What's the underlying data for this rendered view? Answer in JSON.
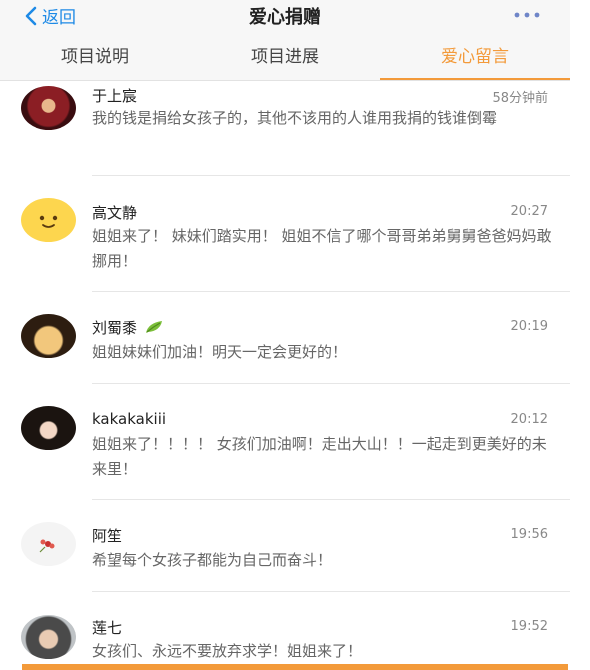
{
  "nav": {
    "back_label": "返回",
    "title": "爱心捐赠"
  },
  "tabs": [
    {
      "label": "项目说明",
      "active": false
    },
    {
      "label": "项目进展",
      "active": false
    },
    {
      "label": "爱心留言",
      "active": true
    }
  ],
  "colors": {
    "accent": "#f39a3a",
    "link": "#1e8ae6"
  },
  "comments": [
    {
      "name": "于上宸",
      "time": "58分钟前",
      "text": "我的钱是捐给女孩子的，其他不该用的人谁用我捐的钱谁倒霉",
      "avatar": "photo-red"
    },
    {
      "name": "高文静",
      "time": "20:27",
      "text": "姐姐来了！ 妹妹们踏实用！ 姐姐不信了哪个哥哥弟弟舅舅爸爸妈妈敢挪用！",
      "avatar": "emoji-smile"
    },
    {
      "name": "刘蜀黍",
      "time": "20:19",
      "text": "姐姐妹妹们加油！明天一定会更好的！",
      "avatar": "photo-face",
      "badge": "leaf-icon"
    },
    {
      "name": "kakakakiii",
      "time": "20:12",
      "text": "姐姐来了！！！！ 女孩们加油啊！走出大山！！一起走到更美好的未来里！",
      "avatar": "photo-girl"
    },
    {
      "name": "阿笙",
      "time": "19:56",
      "text": "希望每个女孩子都能为自己而奋斗！",
      "avatar": "photo-flower"
    },
    {
      "name": "莲七",
      "time": "19:52",
      "text": "女孩们、永远不要放弃求学！姐姐来了！",
      "avatar": "photo-boy"
    }
  ]
}
